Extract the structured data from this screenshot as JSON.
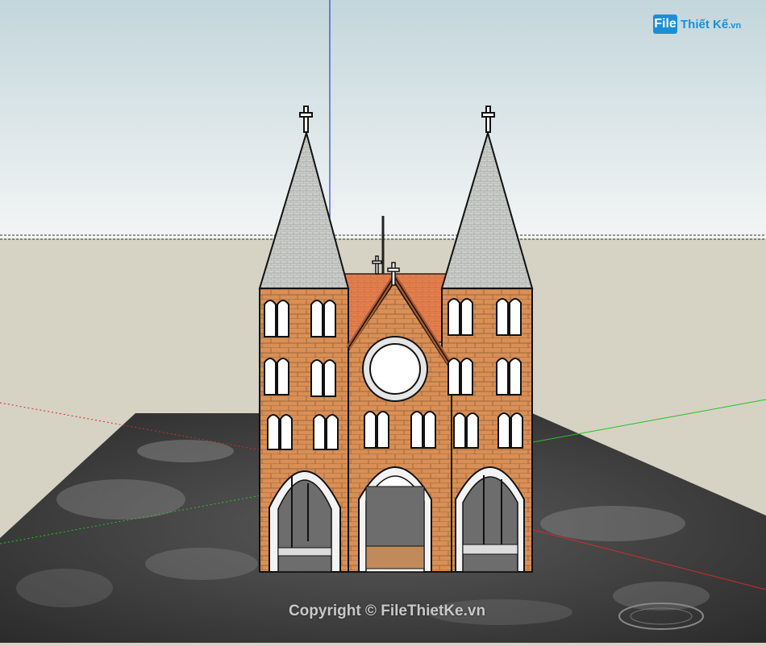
{
  "watermark": {
    "logo_file": "File",
    "logo_rest": "Thiết Kế",
    "logo_domain": ".vn",
    "copyright": "Copyright © FileThietKe.vn"
  },
  "scene": {
    "sky_top": "#c5d7dd",
    "sky_bottom": "#f2f4f4",
    "ground": "#d6d3c4",
    "brick": "#d98f55",
    "roof": "#e5804e",
    "spire": "#c9ccc9",
    "axis_blue": "#2a3fd6",
    "axis_green": "#27c027",
    "axis_red": "#d62a2a"
  },
  "icons": {
    "compass": "navigation-compass-icon",
    "cross": "cross-icon"
  }
}
